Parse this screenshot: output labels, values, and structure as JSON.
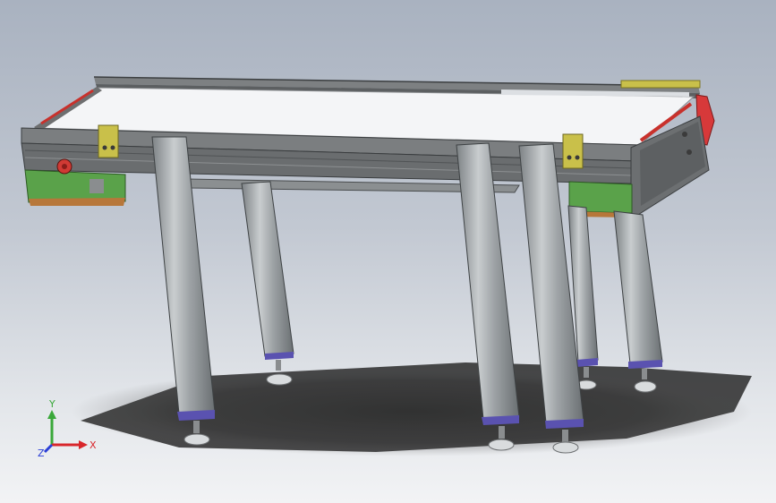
{
  "scene": {
    "description_visible": false,
    "background_top": "#a9b2c0",
    "background_bottom": "#f2f3f5"
  },
  "triad": {
    "x_label": "X",
    "y_label": "Y",
    "z_label": "Z",
    "x_color": "#d8262b",
    "y_color": "#3aa83a",
    "z_color": "#2b3fd6"
  },
  "colors": {
    "belt": "#f4f5f7",
    "frame": "#6f7274",
    "frame_dark": "#4b4e50",
    "leg": "#9ea3a6",
    "leg_light": "#c9cdcf",
    "motor_green": "#5aa24a",
    "bracket_yellow": "#c9c04a",
    "roller_red": "#c8312c",
    "foot": "#d9dcde",
    "leg_cap": "#5a52b0"
  }
}
